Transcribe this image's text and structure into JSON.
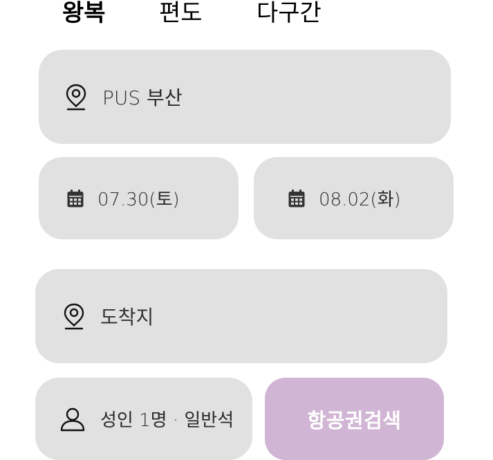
{
  "trip_tabs": [
    {
      "label": "왕복",
      "selected": true
    },
    {
      "label": "편도",
      "selected": false
    },
    {
      "label": "다구간",
      "selected": false
    }
  ],
  "origin": {
    "icon": "location-pin-icon",
    "value": "PUS 부산"
  },
  "dates": {
    "icon": "calendar-icon",
    "departure": "07.30(토)",
    "return": "08.02(화)"
  },
  "destination": {
    "icon": "location-pin-icon",
    "placeholder": "도착지"
  },
  "passengers": {
    "icon": "person-icon",
    "value": "성인 1명 · 일반석"
  },
  "search_button": {
    "label": "항공권검색"
  },
  "colors": {
    "field_bg": "#e1e1e1",
    "search_button_bg": "#d1b5d4",
    "search_button_text": "#ffffff",
    "tab_text": "#000000"
  }
}
